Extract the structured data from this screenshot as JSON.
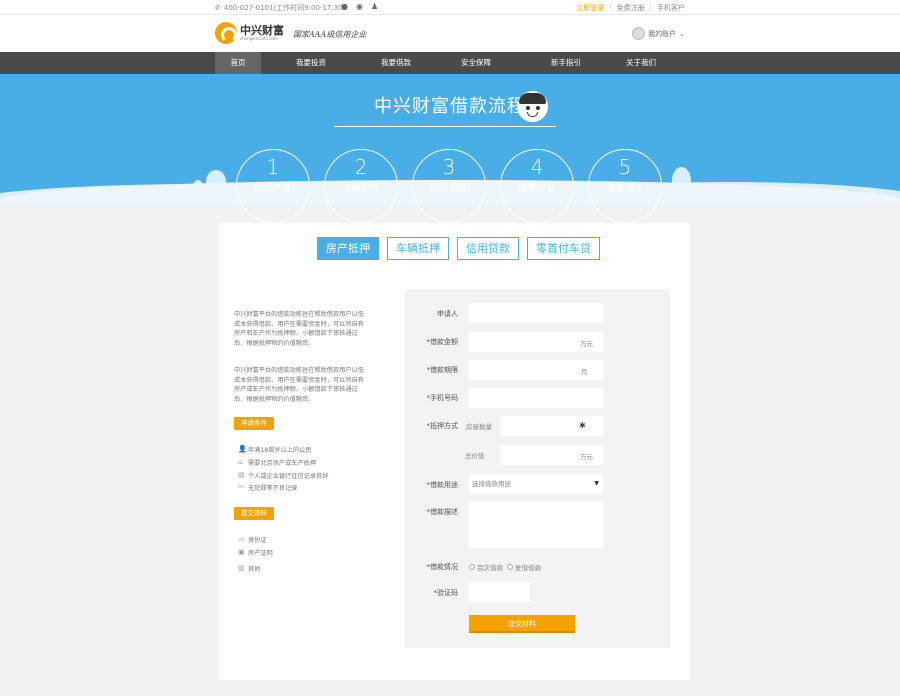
{
  "topbar": {
    "phone": "400-027-0101(工作时间9:00-17:30)",
    "social_icons": [
      "wechat-icon",
      "weibo-icon",
      "qq-icon"
    ],
    "login": "立即登录",
    "register": "免费注册",
    "app": "手机客户"
  },
  "header": {
    "logo_cn": "中兴财富",
    "logo_en": "zhongxincaifu.com",
    "slogan": "国家AAA级信用企业",
    "user": "我的账户"
  },
  "nav": [
    "首页",
    "我要投资",
    "我要借款",
    "安全保障",
    "新手指引",
    "关于我们"
  ],
  "banner": {
    "title": "中兴财富借款流程",
    "steps": [
      {
        "num": "1",
        "label": "提交申请"
      },
      {
        "num": "2",
        "label": "审核资料"
      },
      {
        "num": "3",
        "label": "线下调查"
      },
      {
        "num": "4",
        "label": "签署协议"
      },
      {
        "num": "5",
        "label": "借款成功"
      }
    ]
  },
  "tabs": [
    "房产抵押",
    "车辆抵押",
    "信用贷款",
    "零首付车贷"
  ],
  "left": {
    "desc1": "中兴财富平台的借款功能旨在帮助借款用户以低成本获得借款。用户在需要资金时，可以将自有房产和车产作为抵押物，小额借款下审核通过后，根据抵押物的价值融资。",
    "desc2": "中兴财富平台的借款功能旨在帮助借款用户以低成本获得借款。用户在需要资金时，可以将自有房产或车产作为抵押物，小额借款下审核通过后，根据抵押物的价值融资。",
    "conditions_button": "申请条件",
    "conditions": [
      {
        "icon": "person-icon",
        "text": "年满18周岁以上的公民"
      },
      {
        "icon": "house-icon",
        "text": "需要北京房产或车产抵押"
      },
      {
        "icon": "bank-icon",
        "text": "个人或企业银行征信记录良好"
      },
      {
        "icon": "tools-icon",
        "text": "无犯罪等不良记录"
      }
    ],
    "materials_button": "提交资料",
    "materials": [
      {
        "icon": "id-card-icon",
        "text": "身份证"
      },
      {
        "icon": "certificate-icon",
        "text": "房产证明"
      },
      {
        "icon": "document-icon",
        "text": "其他"
      }
    ]
  },
  "form": {
    "applicant_label": "申请人",
    "amount_label": "*借款金额",
    "amount_unit": "万元",
    "term_label": "*借款期限",
    "term_unit": "月",
    "phone_label": "*手机号码",
    "collateral_label": "*抵押方式",
    "collateral_sub": "房屋数量",
    "collateral_value_label": "总价值",
    "collateral_value_unit": "万元",
    "purpose_label": "*借款用途",
    "purpose_value": "选择借款用途",
    "desc_label": "*借款描述",
    "status_label": "*借款情况",
    "status_options": [
      "首次借款",
      "复借借款"
    ],
    "captcha_label": "*验证码",
    "submit": "提交材料"
  }
}
